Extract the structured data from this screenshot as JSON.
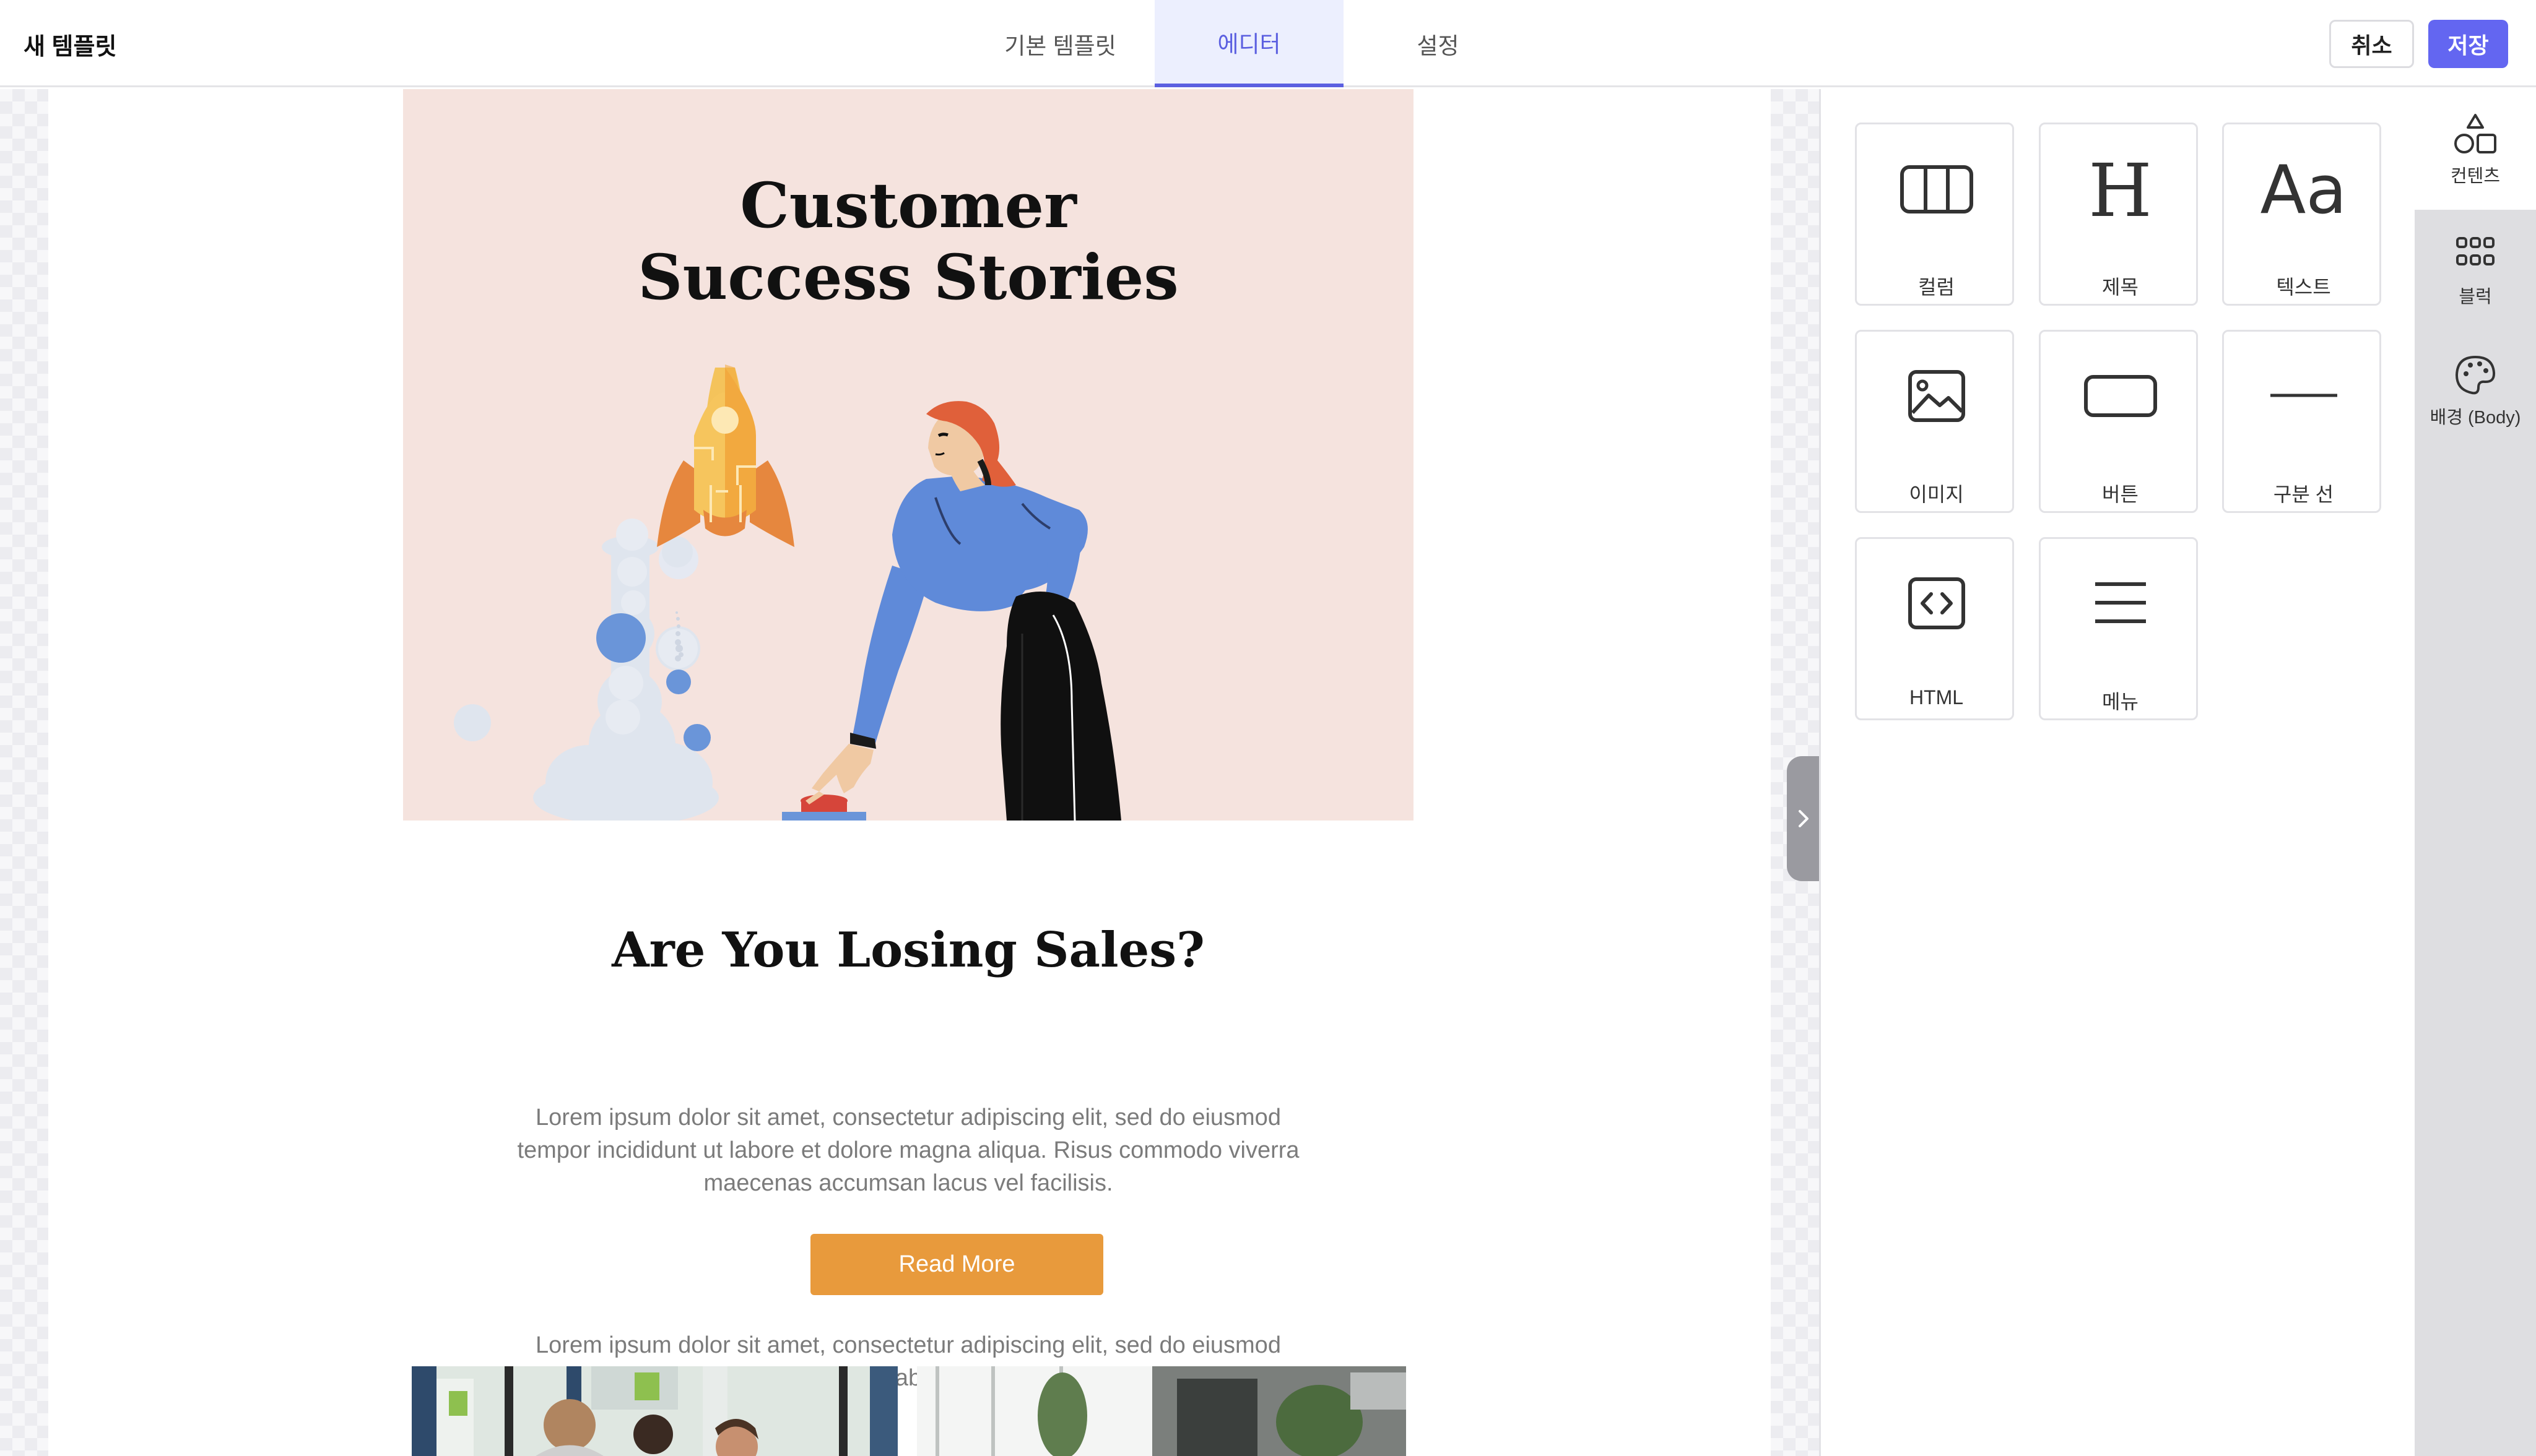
{
  "app": {
    "title": "새 템플릿"
  },
  "tabs": [
    {
      "label": "기본 템플릿",
      "active": false
    },
    {
      "label": "에디터",
      "active": true
    },
    {
      "label": "설정",
      "active": false
    }
  ],
  "actions": {
    "cancel_label": "취소",
    "save_label": "저장"
  },
  "email": {
    "hero_title_line1": "Customer",
    "hero_title_line2": "Success Stories",
    "headline": "Are You Losing Sales?",
    "paragraph1": "Lorem ipsum dolor sit amet, consectetur adipiscing elit, sed do eiusmod tempor incididunt ut labore et dolore magna aliqua. Risus commodo viverra maecenas accumsan lacus vel facilisis.",
    "button_label": "Read More",
    "paragraph2": "Lorem ipsum dolor sit amet, consectetur adipiscing elit, sed do eiusmod tempor incididunt ut labore et dolore magna."
  },
  "content_tiles": [
    {
      "label": "컬럼",
      "icon": "columns-icon"
    },
    {
      "label": "제목",
      "icon": "heading-icon"
    },
    {
      "label": "텍스트",
      "icon": "text-icon"
    },
    {
      "label": "이미지",
      "icon": "image-icon"
    },
    {
      "label": "버튼",
      "icon": "button-icon"
    },
    {
      "label": "구분 선",
      "icon": "divider-icon"
    },
    {
      "label": "HTML",
      "icon": "code-icon"
    },
    {
      "label": "메뉴",
      "icon": "menu-icon"
    }
  ],
  "tile_glyphs": {
    "heading": "H",
    "text": "Aa"
  },
  "rail": [
    {
      "label": "컨텐츠",
      "icon": "shapes-icon",
      "active": true
    },
    {
      "label": "블럭",
      "icon": "blocks-icon",
      "active": false
    },
    {
      "label": "배경 (Body)",
      "icon": "palette-icon",
      "active": false
    }
  ],
  "colors": {
    "accent": "#6366f1",
    "button": "#e89a3c",
    "hero_bg": "#f5e3de"
  }
}
